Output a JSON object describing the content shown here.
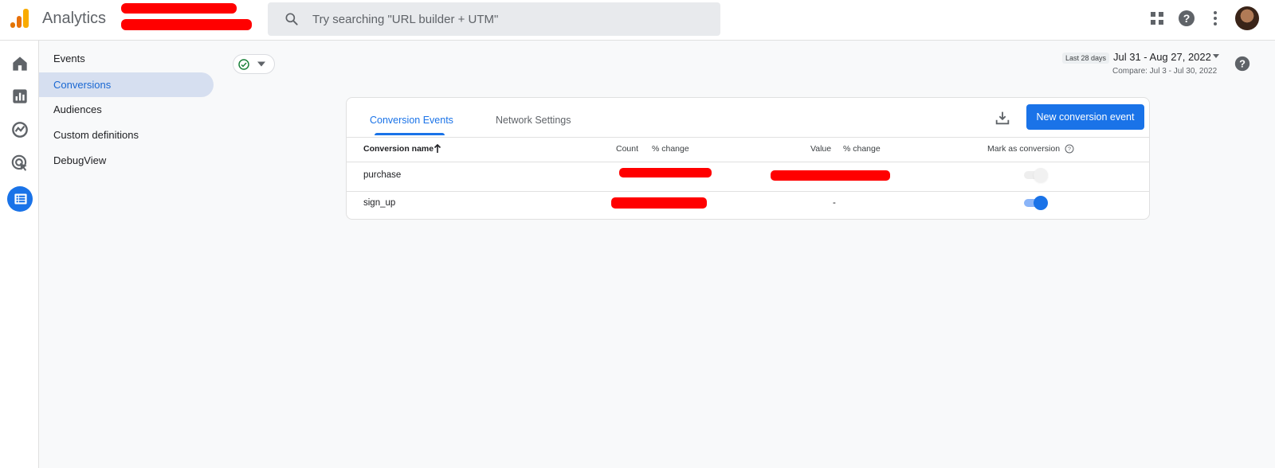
{
  "header": {
    "app_title": "Analytics",
    "search_placeholder": "Try searching \"URL builder + UTM\"",
    "icons": [
      "apps-grid-icon",
      "help-icon",
      "more-vert-icon",
      "avatar"
    ]
  },
  "rail": {
    "items": [
      "home-icon",
      "reports-icon",
      "explore-icon",
      "advertising-icon",
      "configure-icon"
    ],
    "active": "configure-icon",
    "accent": "#1a73e8"
  },
  "subnav": {
    "items": [
      {
        "label": "Events"
      },
      {
        "label": "Conversions",
        "active": true
      },
      {
        "label": "Audiences"
      },
      {
        "label": "Custom definitions"
      },
      {
        "label": "DebugView"
      }
    ]
  },
  "date_range": {
    "preset": "Last 28 days",
    "range": "Jul 31 - Aug 27, 2022",
    "compare": "Compare: Jul 3 - Jul 30, 2022"
  },
  "card": {
    "tabs": [
      {
        "label": "Conversion Events",
        "active": true
      },
      {
        "label": "Network Settings"
      }
    ],
    "new_button": "New conversion event",
    "columns": {
      "name": "Conversion name",
      "count": "Count",
      "count_change": "% change",
      "value": "Value",
      "value_change": "% change",
      "mark": "Mark as conversion"
    },
    "rows": [
      {
        "name": "purchase",
        "value": "",
        "mark_as_conversion": false
      },
      {
        "name": "sign_up",
        "value": "-",
        "mark_as_conversion": true
      }
    ]
  },
  "colors": {
    "primary": "#1a73e8",
    "nav_active_bg": "#d6dff0",
    "redaction": "#ff0000"
  }
}
